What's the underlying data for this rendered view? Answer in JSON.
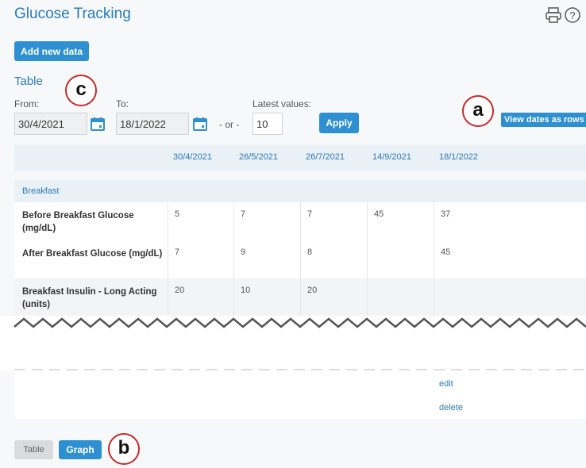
{
  "header": {
    "title": "Glucose Tracking",
    "print_icon": "printer-icon",
    "help_icon": "help-icon"
  },
  "toolbar": {
    "add_label": "Add new data"
  },
  "section": {
    "label": "Table"
  },
  "filters": {
    "from_label": "From:",
    "from_value": "30/4/2021",
    "to_label": "To:",
    "to_value": "18/1/2022",
    "or_label": "- or -",
    "latest_label": "Latest values:",
    "latest_value": "10",
    "apply_label": "Apply"
  },
  "view_rows_label": "View dates as rows",
  "markers": {
    "a": "a",
    "b": "b",
    "c": "c"
  },
  "table": {
    "dates": [
      "30/4/2021",
      "26/5/2021",
      "26/7/2021",
      "14/9/2021",
      "18/1/2022"
    ],
    "group": "Breakfast",
    "rows": [
      {
        "label": "Before Breakfast Glucose (mg/dL)",
        "values": [
          "5",
          "7",
          "7",
          "45",
          "37"
        ]
      },
      {
        "label": "After Breakfast Glucose (mg/dL)",
        "values": [
          "7",
          "9",
          "8",
          "",
          "45"
        ]
      },
      {
        "label": "Breakfast Insulin - Long Acting (units)",
        "values": [
          "20",
          "10",
          "20",
          "",
          ""
        ]
      }
    ],
    "actions": {
      "edit": "edit",
      "delete": "delete"
    }
  },
  "view_toggle": {
    "table": "Table",
    "graph": "Graph"
  },
  "colors": {
    "accent": "#2e90d1",
    "title": "#2a7ab8",
    "marker": "#c72a2a"
  }
}
